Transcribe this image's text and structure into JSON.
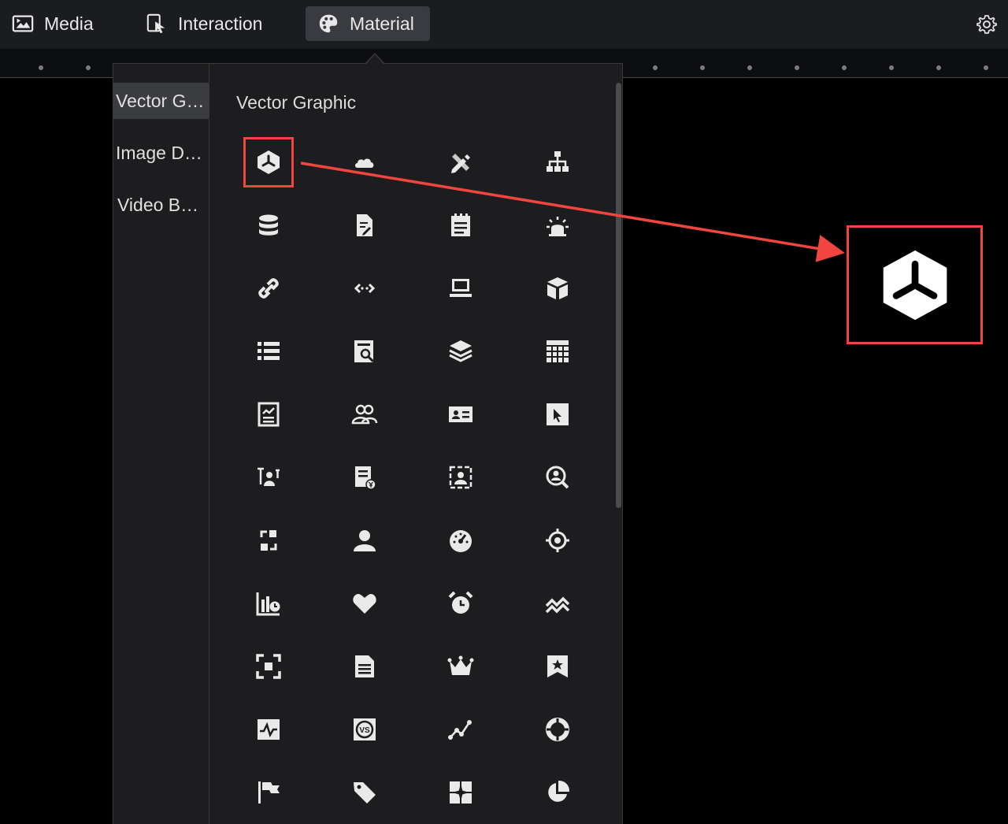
{
  "toolbar": {
    "tabs": [
      {
        "label": "Media",
        "icon": "media-icon"
      },
      {
        "label": "Interaction",
        "icon": "interaction-icon"
      },
      {
        "label": "Material",
        "icon": "palette-icon",
        "active": true
      }
    ],
    "settings_icon": "gear-icon"
  },
  "sidebar": {
    "categories": [
      {
        "label": "Vector G…",
        "active": true
      },
      {
        "label": "Image D…"
      },
      {
        "label": "Video B…"
      }
    ]
  },
  "main": {
    "section_title": "Vector Graphic",
    "icons": [
      "hexagon-icon",
      "cloud-icon",
      "pencil-ruler-icon",
      "sitemap-icon",
      "database-icon",
      "edit-document-icon",
      "notepad-icon",
      "alarm-light-icon",
      "link-icon",
      "code-arrows-icon",
      "laptop-icon",
      "cube-icon",
      "list-icon",
      "document-search-icon",
      "layers-icon",
      "grid-icon",
      "checklist-icon",
      "users-icon",
      "id-card-icon",
      "pointer-icon",
      "user-sort-icon",
      "invoice-icon",
      "user-frame-icon",
      "user-search-icon",
      "sync-icon",
      "user-icon",
      "gauge-icon",
      "target-icon",
      "bar-chart-clock-icon",
      "heart-icon",
      "alarm-clock-icon",
      "trend-icon",
      "focus-icon",
      "document-icon",
      "crown-icon",
      "bookmark-star-icon",
      "pulse-icon",
      "versus-icon",
      "line-chart-icon",
      "lifebuoy-icon",
      "flag-icon",
      "tag-icon",
      "tiles-icon",
      "pie-chart-icon"
    ],
    "highlighted_icon": "hexagon-icon"
  },
  "preview": {
    "icon": "hexagon-icon"
  },
  "colors": {
    "highlight": "#f0463f",
    "icon": "#e9e9e9",
    "panel": "#1d1d1f"
  }
}
